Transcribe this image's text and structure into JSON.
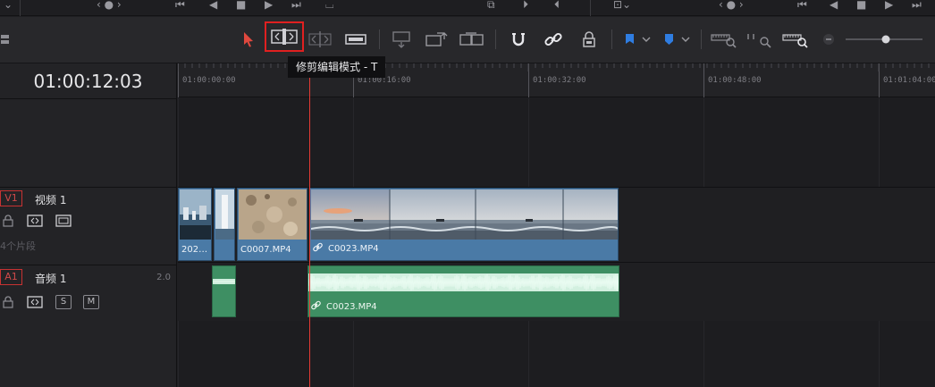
{
  "timecode": "01:00:12:03",
  "tooltip": "修剪编辑模式 - T",
  "ruler": {
    "labels": [
      "01:00:00:00",
      "01:00:16:00",
      "01:00:32:00",
      "01:00:48:00",
      "01:01:04:00"
    ]
  },
  "tracks": {
    "video": {
      "tag": "V1",
      "name": "视频 1",
      "clip_count": "4个片段"
    },
    "audio": {
      "tag": "A1",
      "name": "音频 1",
      "level": "2.0",
      "solo_label": "S",
      "mute_label": "M"
    }
  },
  "clips": {
    "video": [
      {
        "label": "202…"
      },
      {
        "label": ""
      },
      {
        "label": "C0007.MP4"
      },
      {
        "label": "C0023.MP4"
      }
    ],
    "audio": [
      {
        "label": ""
      },
      {
        "label": "C0023.MP4"
      }
    ]
  },
  "icons": {
    "toolbar": [
      "selection-arrow-icon",
      "trim-edit-mode-icon",
      "dynamic-trim-icon",
      "blade-edit-icon",
      "insert-clip-icon",
      "overwrite-clip-icon",
      "replace-clip-icon",
      "snapping-icon",
      "linked-selection-icon",
      "position-lock-icon",
      "flag-icon",
      "marker-icon",
      "zoom-full-icon",
      "zoom-detail-icon",
      "zoom-custom-icon",
      "zoom-out-icon",
      "zoom-slider"
    ]
  },
  "colors": {
    "accent_red": "#e53b34",
    "video_clip": "#4a7aa6",
    "audio_clip": "#3e8f63",
    "flag_blue": "#2f7de1",
    "highlight_box": "#e02020"
  }
}
